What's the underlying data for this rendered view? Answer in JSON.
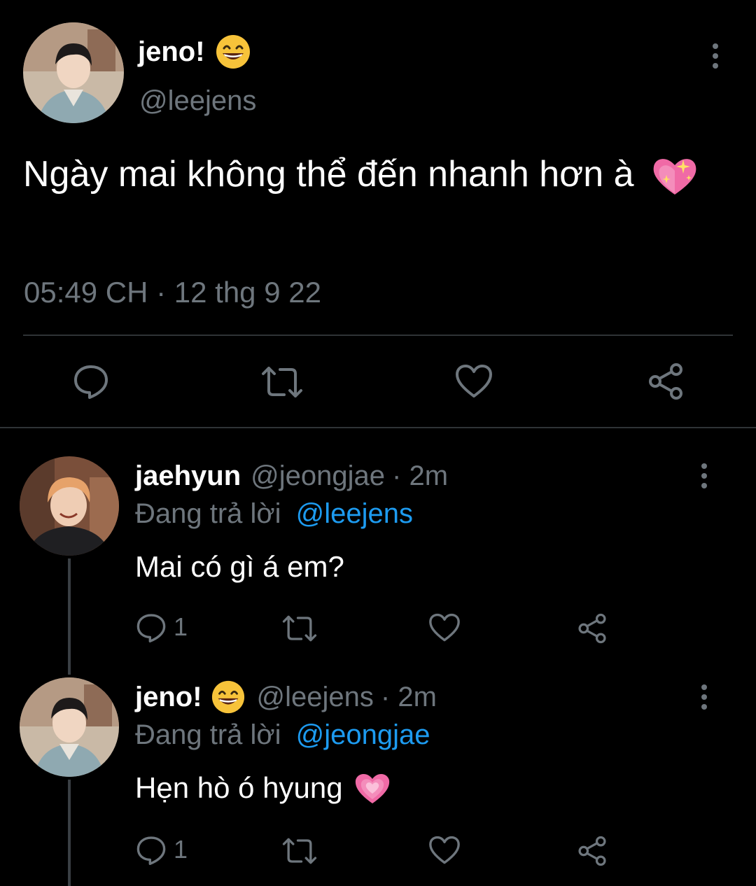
{
  "main_tweet": {
    "display_name": "jeno!",
    "handle": "@leejens",
    "text": "Ngày mai không thể đến nhanh hơn à",
    "timestamp": "05:49 CH · 12 thg 9 22",
    "name_emoji_icon": "grinning-face-icon",
    "text_emoji_icon": "sparkling-heart-icon"
  },
  "actions": {
    "reply_icon": "reply-icon",
    "retweet_icon": "retweet-icon",
    "like_icon": "heart-icon",
    "share_icon": "share-icon"
  },
  "replies": [
    {
      "display_name": "jaehyun",
      "handle": "@jeongjae",
      "time": "· 2m",
      "replying_prefix": "Đang trả lời",
      "replying_to": "@leejens",
      "text": "Mai có gì á em?",
      "reply_count": "1"
    },
    {
      "display_name": "jeno!",
      "handle": "@leejens",
      "time": "· 2m",
      "replying_prefix": "Đang trả lời",
      "replying_to": "@jeongjae",
      "text": "Hẹn hò ó hyung",
      "reply_count": "1",
      "name_emoji_icon": "grinning-face-icon",
      "text_emoji_icon": "growing-heart-icon"
    }
  ],
  "colors": {
    "background": "#000000",
    "muted": "#6e767d",
    "link": "#1d9bf0",
    "divider": "#2f3336"
  }
}
